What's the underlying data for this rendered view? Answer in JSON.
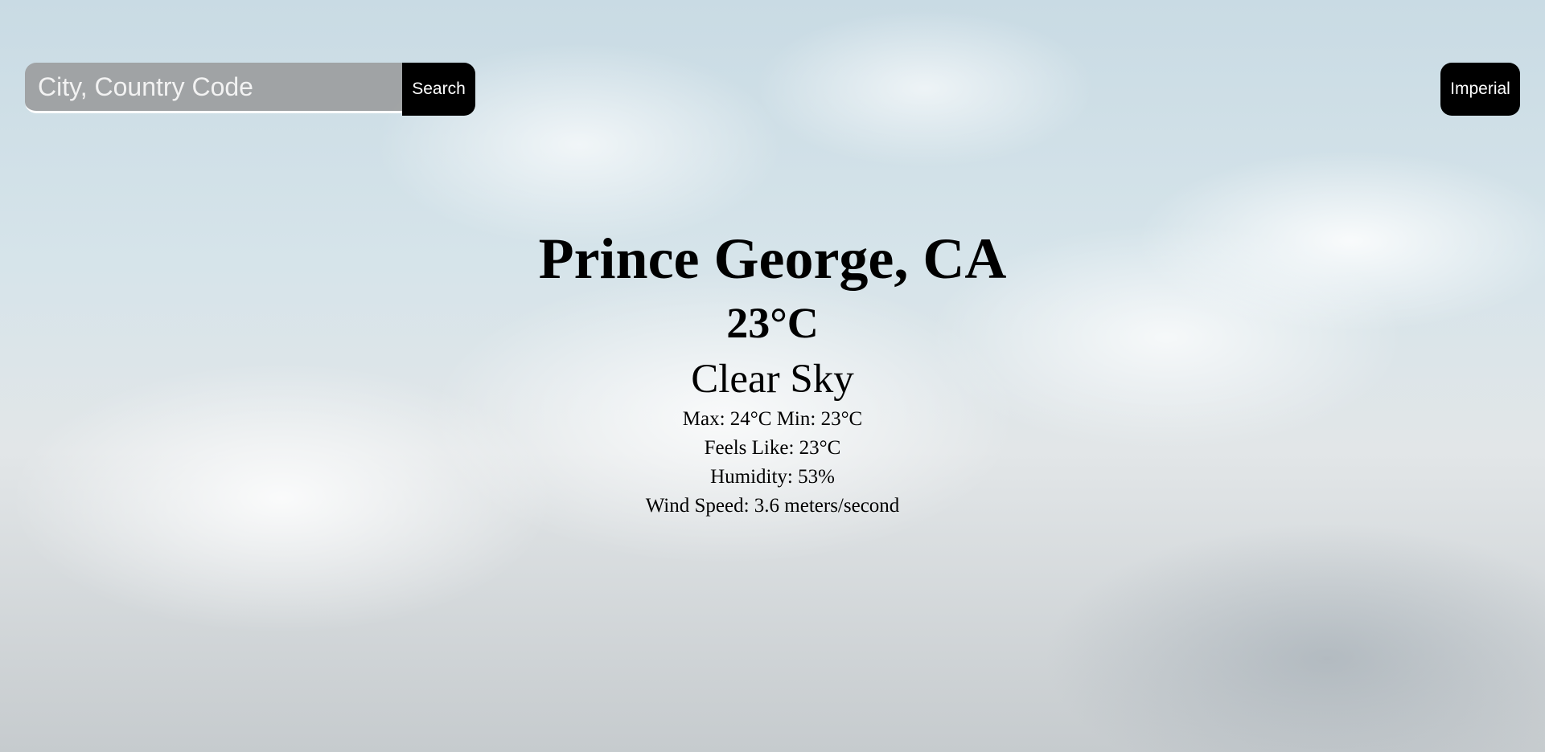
{
  "search": {
    "placeholder": "City, Country Code",
    "value": "",
    "button_label": "Search"
  },
  "units_toggle": {
    "label": "Imperial"
  },
  "weather": {
    "location": "Prince George, CA",
    "temperature": "23°C",
    "description": "Clear Sky",
    "max_min": "Max: 24°C Min: 23°C",
    "feels_like": "Feels Like: 23°C",
    "humidity": "Humidity: 53%",
    "wind_speed": "Wind Speed: 3.6 meters/second"
  },
  "colors": {
    "button_background": "#000000",
    "button_text": "#ffffff",
    "input_background": "#969696",
    "text": "#000000"
  }
}
